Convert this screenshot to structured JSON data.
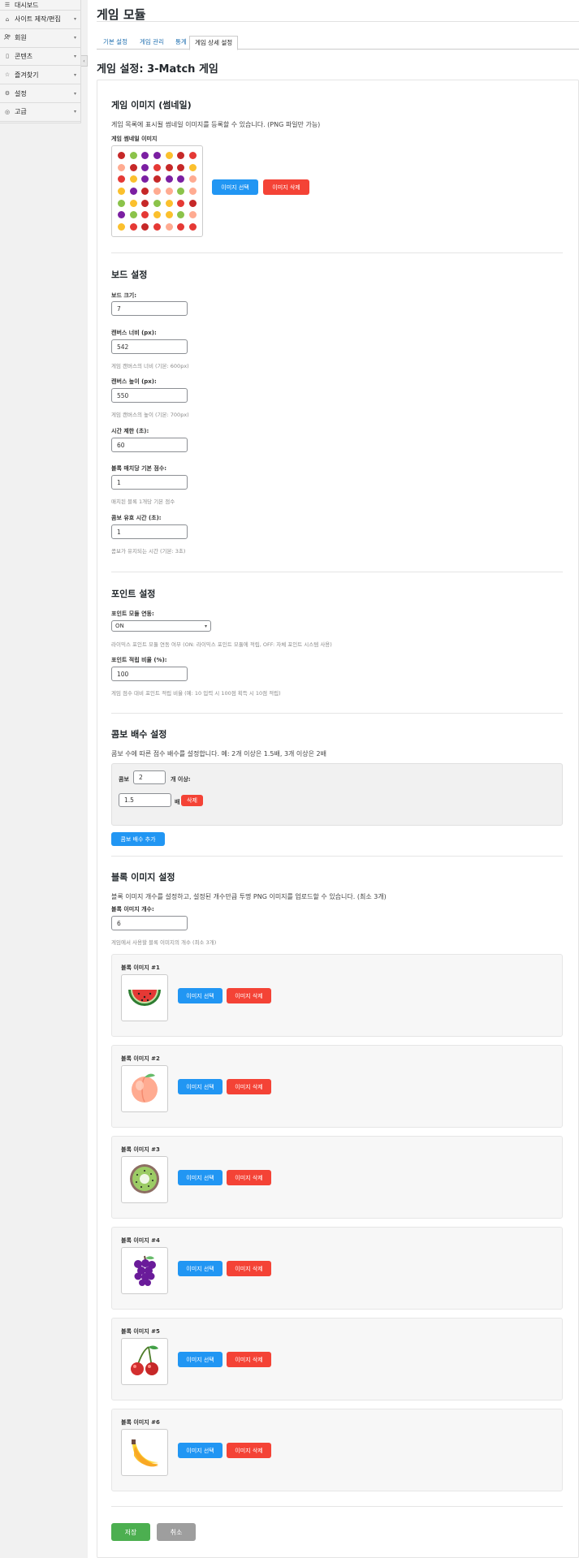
{
  "sidebar": {
    "items": [
      {
        "label": "대시보드",
        "icon": "dashboard-icon",
        "glyph": "☰"
      },
      {
        "label": "사이트 제작/편집",
        "icon": "home-icon",
        "glyph": "⌂"
      },
      {
        "label": "회원",
        "icon": "users-icon",
        "glyph": "👥"
      },
      {
        "label": "콘텐츠",
        "icon": "document-icon",
        "glyph": "▯"
      },
      {
        "label": "즐겨찾기",
        "icon": "star-icon",
        "glyph": "☆"
      },
      {
        "label": "설정",
        "icon": "gear-icon",
        "glyph": "⚙"
      },
      {
        "label": "고급",
        "icon": "pin-icon",
        "glyph": "◎"
      }
    ],
    "toggle_glyph": "‹"
  },
  "page_title": "게임 모듈",
  "tabs": [
    {
      "label": "기본 설정"
    },
    {
      "label": "게임 관리"
    },
    {
      "label": "통계"
    },
    {
      "label": "게임 상세 설정"
    }
  ],
  "section_title": "게임 설정: 3-Match 게임",
  "thumbnail": {
    "heading": "게임 이미지 (썸네일)",
    "description": "게임 목록에 표시될 썸네일 이미지를 등록할 수 있습니다. (PNG 파일만 가능)",
    "label": "게임 썸네일 이미지",
    "select_label": "이미지 선택",
    "delete_label": "이미지 삭제"
  },
  "board": {
    "heading": "보드 설정",
    "board_size": {
      "label": "보드 크기:",
      "value": "7"
    },
    "canvas_width": {
      "label": "캔버스 너비 (px):",
      "value": "542",
      "hint": "게임 캔버스의 너비 (기본: 600px)"
    },
    "canvas_height": {
      "label": "캔버스 높이 (px):",
      "value": "550",
      "hint": "게임 캔버스의 높이 (기본: 700px)"
    },
    "time_limit": {
      "label": "시간 제한 (초):",
      "value": "60"
    },
    "match_score": {
      "label": "블록 매치당 기본 점수:",
      "value": "1",
      "hint": "매치된 블록 1개당 기본 점수"
    },
    "combo_time": {
      "label": "콤보 유효 시간 (초):",
      "value": "1",
      "hint": "콤보가 유지되는 시간 (기본: 3초)"
    }
  },
  "points": {
    "heading": "포인트 설정",
    "module_link": {
      "label": "포인트 모듈 연동:",
      "value": "ON",
      "hint": "라이믹스 포인트 모듈 연동 여부 (ON: 라이믹스 포인트 모듈에 적립, OFF: 자체 포인트 시스템 사용)"
    },
    "ratio": {
      "label": "포인트 적립 비율 (%):",
      "value": "100",
      "hint": "게임 점수 대비 포인트 적립 비율 (예: 10 입력 시 100점 획득 시 10점 적립)"
    }
  },
  "combo": {
    "heading": "콤보 배수 설정",
    "description": "콤보 수에 따른 점수 배수를 설정합니다. 예: 2개 이상은 1.5배, 3개 이상은 2배",
    "prefix": "콤보",
    "count": "2",
    "suffix": "개 이상:",
    "multiplier": "1.5",
    "multiplier_unit": "배",
    "delete_label": "삭제",
    "add_label": "콤보 배수 추가"
  },
  "blocks": {
    "heading": "블록 이미지 설정",
    "description": "블록 이미지 개수를 설정하고, 설정된 개수만큼 투명 PNG 이미지를 업로드할 수 있습니다. (최소 3개)",
    "count_label": "블록 이미지 개수:",
    "count_value": "6",
    "count_hint": "게임에서 사용할 블록 이미지의 개수 (최소 3개)",
    "select_label": "이미지 선택",
    "delete_label": "이미지 삭제",
    "items": [
      {
        "label": "블록 이미지 #1",
        "fruit": "watermelon-icon"
      },
      {
        "label": "블록 이미지 #2",
        "fruit": "peach-icon"
      },
      {
        "label": "블록 이미지 #3",
        "fruit": "kiwi-icon"
      },
      {
        "label": "블록 이미지 #4",
        "fruit": "grapes-icon"
      },
      {
        "label": "블록 이미지 #5",
        "fruit": "cherries-icon"
      },
      {
        "label": "블록 이미지 #6",
        "fruit": "banana-icon"
      }
    ]
  },
  "footer": {
    "save_label": "저장",
    "cancel_label": "취소"
  },
  "colors": {
    "blue": "#2196f3",
    "red": "#f44336",
    "green": "#4caf50",
    "gray": "#9e9e9e"
  }
}
